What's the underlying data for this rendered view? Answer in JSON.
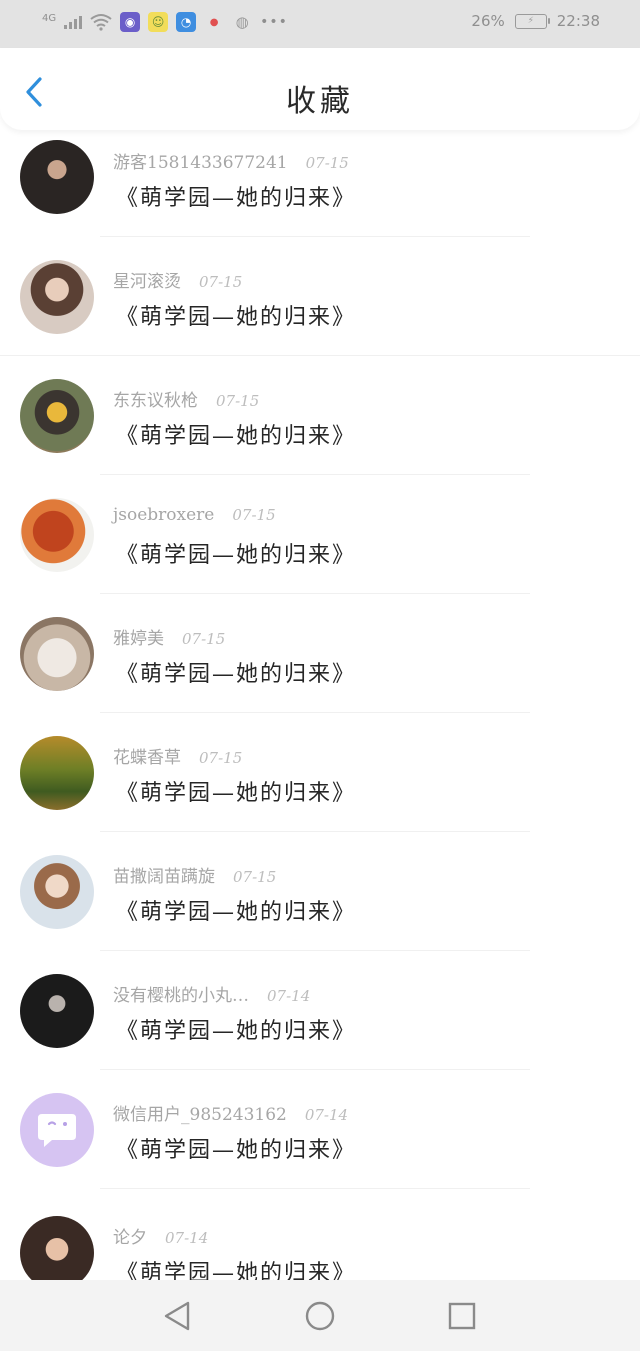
{
  "status_bar": {
    "network": "4G",
    "battery_pct": "26%",
    "time": "22:38"
  },
  "header": {
    "title": "收藏",
    "back_icon": "chevron-left-icon"
  },
  "items": [
    {
      "username": "游客1581433677241",
      "date": "07-15",
      "title": "《萌学园—她的归来》"
    },
    {
      "username": "星河滚烫",
      "date": "07-15",
      "title": "《萌学园—她的归来》"
    },
    {
      "username": "东东议秋枪",
      "date": "07-15",
      "title": "《萌学园—她的归来》"
    },
    {
      "username": "jsoebroxere",
      "date": "07-15",
      "title": "《萌学园—她的归来》"
    },
    {
      "username": "雅婷美",
      "date": "07-15",
      "title": "《萌学园—她的归来》"
    },
    {
      "username": "花蝶香草",
      "date": "07-15",
      "title": "《萌学园—她的归来》"
    },
    {
      "username": "苗撒阔苗蹒旋",
      "date": "07-15",
      "title": "《萌学园—她的归来》"
    },
    {
      "username": "没有樱桃的小丸…",
      "date": "07-14",
      "title": "《萌学园—她的归来》"
    },
    {
      "username": "微信用户_985243162",
      "date": "07-14",
      "title": "《萌学园—她的归来》"
    },
    {
      "username": "论夕",
      "date": "07-14",
      "title": "《萌学园—她的归来》"
    }
  ],
  "nav": {
    "back": "triangle-back-icon",
    "home": "circle-home-icon",
    "recent": "square-recent-icon"
  }
}
